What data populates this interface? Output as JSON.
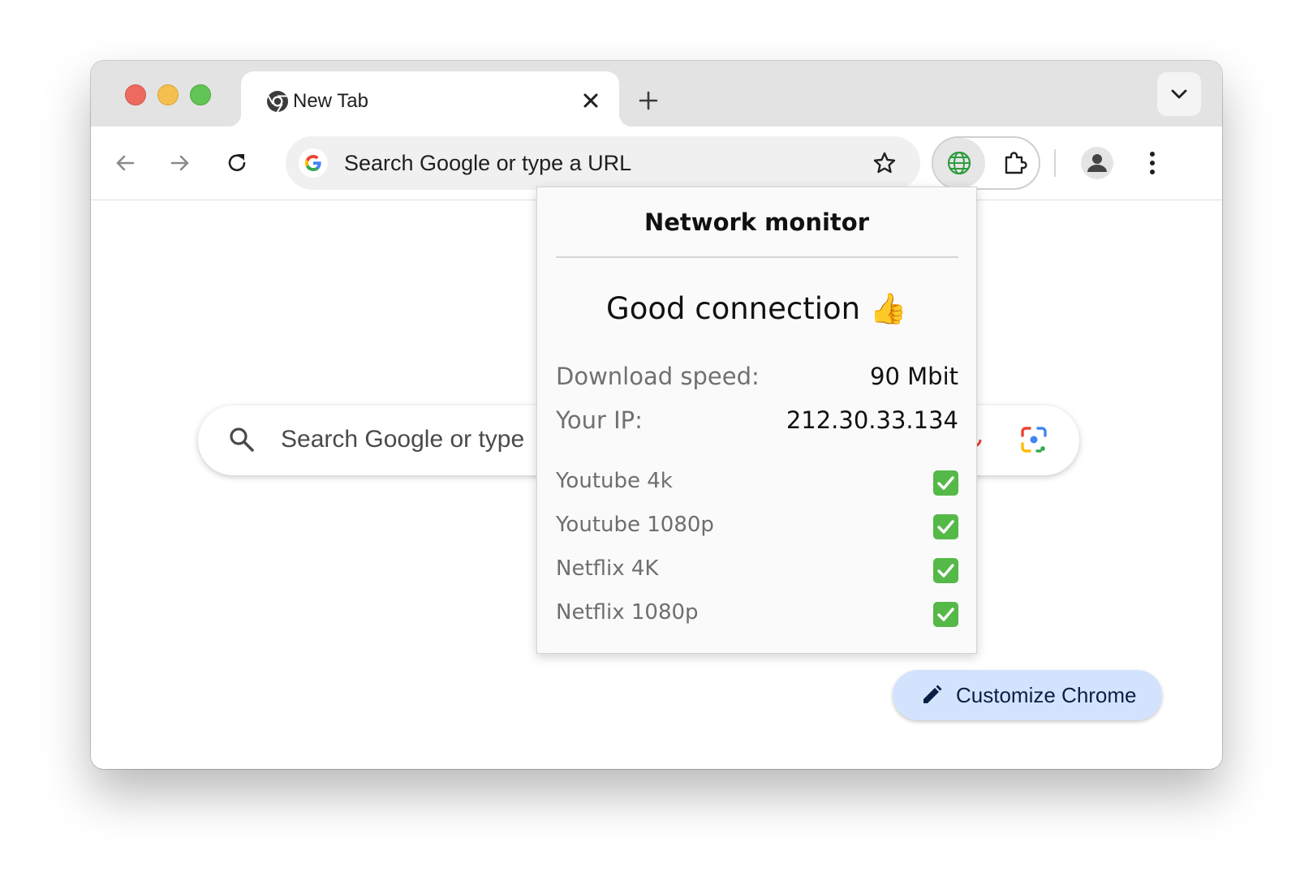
{
  "tab": {
    "title": "New Tab"
  },
  "omnibox": {
    "placeholder": "Search Google or type a URL"
  },
  "ntp": {
    "search_text": "Search Google or type",
    "customize_label": "Customize Chrome"
  },
  "popup": {
    "title": "Network monitor",
    "status": "Good connection 👍",
    "stats": [
      {
        "label": "Download speed:",
        "value": "90 Mbit"
      },
      {
        "label": "Your IP:",
        "value": "212.30.33.134"
      }
    ],
    "services": [
      {
        "label": "Youtube 4k",
        "ok": true
      },
      {
        "label": "Youtube 1080p",
        "ok": true
      },
      {
        "label": "Netflix 4K",
        "ok": true
      },
      {
        "label": "Netflix 1080p",
        "ok": true
      }
    ]
  },
  "colors": {
    "accent_blue": "#d3e3fd",
    "check_green": "#55b948",
    "globe_green": "#2e9b3e"
  }
}
